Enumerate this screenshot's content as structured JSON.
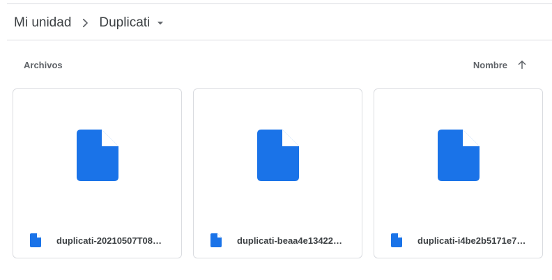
{
  "breadcrumb": {
    "root": "Mi unidad",
    "current": "Duplicati"
  },
  "section": {
    "label": "Archivos"
  },
  "sort": {
    "label": "Nombre",
    "direction": "ascending"
  },
  "colors": {
    "file_blue": "#1a73e8",
    "text": "#3c4043",
    "muted": "#5f6368",
    "border": "#dadce0"
  },
  "files": [
    {
      "name": "duplicati-20210507T08…",
      "icon": "file-icon"
    },
    {
      "name": "duplicati-beaa4e13422…",
      "icon": "file-icon"
    },
    {
      "name": "duplicati-i4be2b5171e7…",
      "icon": "file-icon"
    }
  ]
}
